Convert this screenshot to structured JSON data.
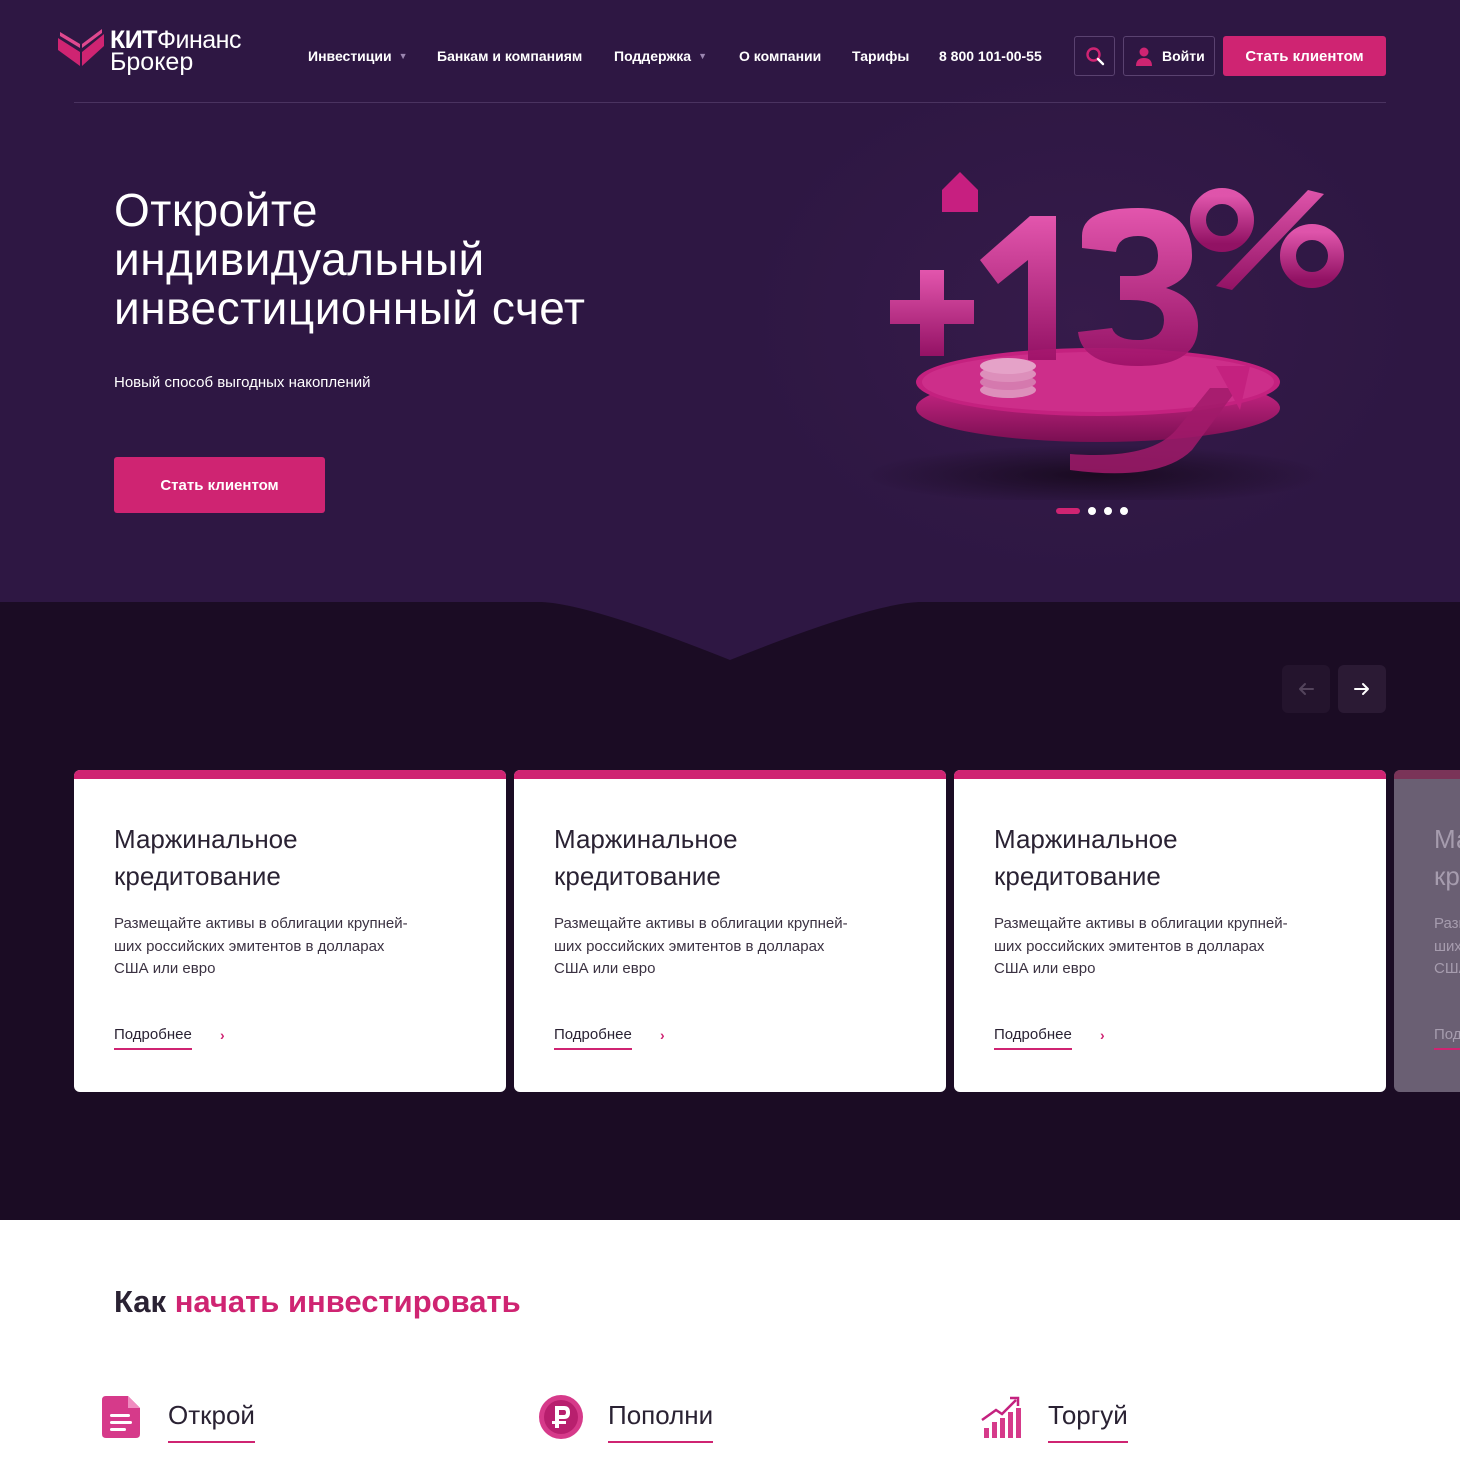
{
  "header": {
    "logo_bold": "КИТ",
    "logo_rest": "Финанс",
    "logo_line2": "Брокер",
    "nav": [
      {
        "label": "Инвестиции",
        "has_dropdown": true
      },
      {
        "label": "Банкам и компаниям",
        "has_dropdown": false
      },
      {
        "label": "Поддержка",
        "has_dropdown": true
      },
      {
        "label": "О компании",
        "has_dropdown": false
      },
      {
        "label": "Тарифы",
        "has_dropdown": false
      }
    ],
    "phone": "8 800 101-00-55",
    "login_label": "Войти",
    "cta_label": "Стать клиентом"
  },
  "hero": {
    "title_line1": "Откройте",
    "title_line2": "индивидуальный",
    "title_line3": "инвестиционный счет",
    "subtitle": "Новый способ выгодных накоплений",
    "cta_label": "Стать клиентом",
    "art_text": "+13%",
    "slides_total": 4,
    "slide_active": 1
  },
  "cards": [
    {
      "title_l1": "Маржинальное",
      "title_l2": "кредитование",
      "desc_l1": "Размещайте активы в облигации крупней-",
      "desc_l2": "ших российских эмитентов в долларах",
      "desc_l3": "США или евро",
      "link": "Подробнее"
    },
    {
      "title_l1": "Маржинальное",
      "title_l2": "кредитование",
      "desc_l1": "Размещайте активы в облигации крупней-",
      "desc_l2": "ших российских эмитентов в долларах",
      "desc_l3": "США или евро",
      "link": "Подробнее"
    },
    {
      "title_l1": "Маржинальное",
      "title_l2": "кредитование",
      "desc_l1": "Размещайте активы в облигации крупней-",
      "desc_l2": "ших российских эмитентов в долларах",
      "desc_l3": "США или евро",
      "link": "Подробнее"
    },
    {
      "title_l1": "Маржинальное",
      "title_l2": "кредитование",
      "desc_l1": "Размещайте активы в облигации крупней-",
      "desc_l2": "ших российских эмитентов в долларах",
      "desc_l3": "США или евро",
      "link": "Подробнее"
    }
  ],
  "how": {
    "title_plain": "Как",
    "title_accent": "начать инвестировать",
    "steps": [
      {
        "label": "Открой",
        "icon": "document-icon"
      },
      {
        "label": "Пополни",
        "icon": "ruble-coin-icon"
      },
      {
        "label": "Торгуй",
        "icon": "growth-chart-icon"
      }
    ]
  },
  "colors": {
    "accent": "#cf2472",
    "hero_bg": "#2e1743",
    "dark_bg": "#1b0c24"
  }
}
